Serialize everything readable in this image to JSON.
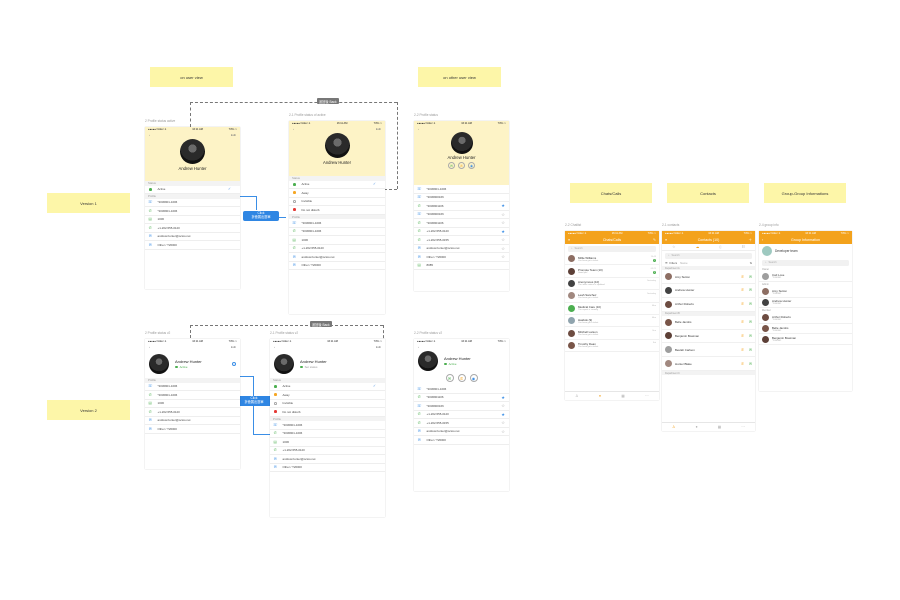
{
  "notes": {
    "on_user_view": "on user view",
    "on_other_user_view": "on other user view",
    "version1": "Version 1",
    "version2": "Version 2",
    "chats_calls": "Chats/Calls",
    "contacts": "Contacts",
    "group_info": "Group-Group Informations"
  },
  "captions": {
    "p1": "2 Profile status active",
    "p2": "2-1 Profile status of active",
    "p3": "2-2 Profile status",
    "p4": "2 Profile status v2",
    "p5": "2-1 Profile status v2",
    "p6": "2-2 Profile status v2",
    "chat": "2-2 Chatlist",
    "contacts": "2-1 contacts",
    "group": "2-4 group info"
  },
  "tags": {
    "back1": "返回後 Back",
    "back2": "返回後 Back"
  },
  "click": {
    "label1": "Click",
    "sub1": "折疊展出選單",
    "label2": "Click",
    "sub2": "折疊展出選單"
  },
  "statusbar": {
    "carrier": "●●●●● Ooker ✈",
    "time": "16:11 AM",
    "battery": "73% ▭"
  },
  "nav": {
    "back": "‹",
    "edit": "Edit"
  },
  "user": {
    "name": "Andrew Hunter",
    "status": "Active",
    "status_sub": "Set status"
  },
  "sections": {
    "status": "Status",
    "profile": "Profile"
  },
  "status_options": [
    {
      "label": "Active",
      "color": "#4caf50"
    },
    {
      "label": "Away",
      "color": "#f5a623"
    },
    {
      "label": "Invisible",
      "color": "#ffffff"
    },
    {
      "label": "Do not disturb",
      "color": "#e53935"
    }
  ],
  "profile_rows": [
    {
      "icon": "☏",
      "text": "*2030901-1006"
    },
    {
      "icon": "✆",
      "text": "*2030901-1006"
    },
    {
      "icon": "▤",
      "text": "1006"
    },
    {
      "icon": "✆",
      "text": "+1-202-555-0120"
    },
    {
      "icon": "✉",
      "text": "andrew.hunter@octos.net"
    },
    {
      "icon": "✉",
      "text": "Other / T20000"
    }
  ],
  "other_rows": [
    {
      "icon": "☏",
      "text": "*2030901-1006",
      "star": ""
    },
    {
      "icon": "☏",
      "text": "*2030900166",
      "star": ""
    },
    {
      "icon": "✆",
      "text": "*2030901106",
      "star": "★"
    },
    {
      "icon": "☏",
      "text": "*2030900166",
      "star": "☆"
    },
    {
      "icon": "✆",
      "text": "*2030901106",
      "star": "☆"
    },
    {
      "icon": "✆",
      "text": "+1-202-555-0120",
      "star": "★"
    },
    {
      "icon": "✆",
      "text": "+1-202-555-0155",
      "star": "☆"
    },
    {
      "icon": "✉",
      "text": "andrew.hunter@octos.net",
      "star": "☆"
    },
    {
      "icon": "✉",
      "text": "Other / T20000",
      "star": "☆"
    },
    {
      "icon": "▤",
      "text": "8085",
      "star": ""
    }
  ],
  "other_rows_v2": [
    {
      "icon": "☏",
      "text": "*2030901-1006",
      "star": ""
    },
    {
      "icon": "✆",
      "text": "*2030901106",
      "star": "★"
    },
    {
      "icon": "☏",
      "text": "*2030900166",
      "star": "☆"
    },
    {
      "icon": "✆",
      "text": "+1-202-555-0120",
      "star": "★"
    },
    {
      "icon": "✆",
      "text": "+1-202-555-0155",
      "star": "☆"
    },
    {
      "icon": "✉",
      "text": "andrew.hunter@octos.net",
      "star": "☆"
    },
    {
      "icon": "✉",
      "text": "Other / T20000",
      "star": ""
    }
  ],
  "chat": {
    "title": "Chats/Calls",
    "search": "Search",
    "items": [
      {
        "name": "Millie Williams",
        "sub": "You have got a ticket",
        "time": "10:49",
        "badge": "1",
        "color": "#8d6e63"
      },
      {
        "name": "Promote Team (10)",
        "sub": "Good job!",
        "time": "09:21",
        "badge": "3",
        "color": "#5d4037"
      },
      {
        "name": "Anonymous (10)",
        "sub": "The inline notice is updated",
        "time": "Yesterday",
        "badge": "",
        "color": "#424242"
      },
      {
        "name": "Leah Sanchez",
        "sub": "You have got a ticket",
        "time": "Yesterday",
        "badge": "",
        "color": "#a1887f"
      },
      {
        "name": "Medical Care (10)",
        "sub": "The report is coming",
        "time": "Mon",
        "badge": "",
        "color": "#4caf50"
      },
      {
        "name": "Hasbok (9)",
        "sub": "You have got a ticket",
        "time": "Mon",
        "badge": "",
        "color": "#90a4ae"
      },
      {
        "name": "Mitchell Larson",
        "sub": "You have got a ticket",
        "time": "Sun",
        "badge": "",
        "color": "#6d4c41"
      },
      {
        "name": "Timothy Dean",
        "sub": "You have got a ticket",
        "time": "Sat",
        "badge": "",
        "color": "#795548"
      }
    ]
  },
  "contacts": {
    "title": "Contacts (10)",
    "search": "Search",
    "filter": "Filters",
    "filter_value": "Name",
    "sections": [
      {
        "label": "Department A",
        "people": [
          "Amy Sutton",
          "Andrew Hunter",
          "Arthur Roberts"
        ]
      },
      {
        "label": "Department B",
        "people": [
          "Belle Jacobs",
          "Benjamin Bowman",
          "Beulah Carlson",
          "Hunter Blake"
        ]
      },
      {
        "label": "Department C",
        "people": []
      }
    ]
  },
  "group": {
    "title": "Group Information",
    "name": "Developer team",
    "search": "Search",
    "owner_label": "Owner",
    "owner": {
      "name": "Carl Love",
      "sub": "*2030901"
    },
    "admin_label": "Admin",
    "admins": [
      {
        "name": "Amy Sutton",
        "sub": "*2030901"
      },
      {
        "name": "Andrew Hunter",
        "sub": "*2030901"
      }
    ],
    "member_label": "Member",
    "members": [
      {
        "name": "Arthur Roberts",
        "sub": "*2030901"
      },
      {
        "name": "Belle Jacobs",
        "sub": "*2030901"
      },
      {
        "name": "Benjamin Bowman",
        "sub": "*2030901"
      }
    ]
  },
  "colors": {
    "accent": "#f3a21c",
    "link": "#3a8ee6",
    "active": "#4caf50"
  }
}
